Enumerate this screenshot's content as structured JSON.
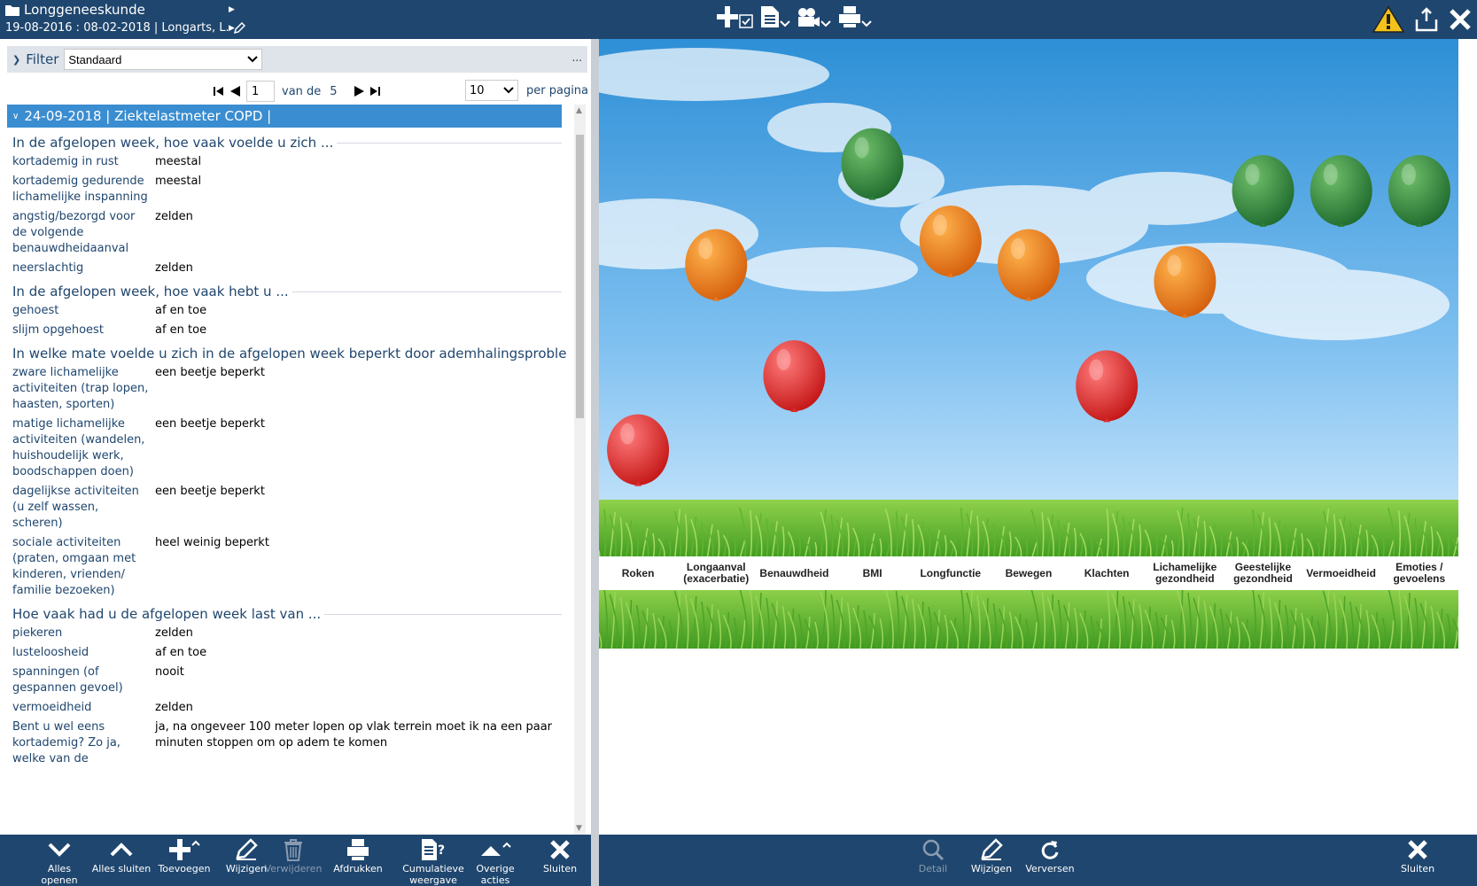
{
  "header": {
    "title": "Longgeneeskunde",
    "subtitle": "19-08-2016 : 08-02-2018 | Longarts, L."
  },
  "filter": {
    "label": "Filter",
    "selected": "Standaard",
    "more": "..."
  },
  "pager": {
    "page": "1",
    "of_label": "van de",
    "total": "5",
    "page_size": "10",
    "per_page_label": "per pagina"
  },
  "record": {
    "group_header": "24-09-2018 | Ziektelastmeter COPD |",
    "sections": [
      {
        "title": "In de afgelopen week, hoe vaak voelde u zich ...",
        "rows": [
          {
            "label": "kortademig in rust",
            "value": "meestal"
          },
          {
            "label": "kortademig gedurende lichamelijke inspanning",
            "value": "meestal"
          },
          {
            "label": "angstig/bezorgd voor de volgende benauwdheidaanval",
            "value": "zelden"
          },
          {
            "label": "neerslachtig",
            "value": "zelden"
          }
        ]
      },
      {
        "title": "In de afgelopen week, hoe vaak hebt u ...",
        "rows": [
          {
            "label": "gehoest",
            "value": "af en toe"
          },
          {
            "label": "slijm opgehoest",
            "value": "af en toe"
          }
        ]
      },
      {
        "title": "In welke mate voelde u zich in de afgelopen week beperkt door ademhalingsproblemen",
        "rows": [
          {
            "label": "zware lichamelijke activiteiten (trap lopen, haasten, sporten)",
            "value": "een beetje beperkt"
          },
          {
            "label": "matige lichamelijke activiteiten (wandelen, huishoudelijk werk, boodschappen doen)",
            "value": "een beetje beperkt"
          },
          {
            "label": "dagelijkse activiteiten (u zelf wassen, scheren)",
            "value": "een beetje beperkt"
          },
          {
            "label": "sociale activiteiten (praten, omgaan met kinderen, vrienden/ familie bezoeken)",
            "value": "heel weinig beperkt"
          }
        ]
      },
      {
        "title": "Hoe vaak had u de afgelopen week last van ...",
        "rows": [
          {
            "label": "piekeren",
            "value": "zelden"
          },
          {
            "label": "lusteloosheid",
            "value": "af en toe"
          },
          {
            "label": "spanningen (of gespannen gevoel)",
            "value": "nooit"
          },
          {
            "label": "vermoeidheid",
            "value": "zelden"
          },
          {
            "label": "Bent u wel eens kortademig? Zo ja, welke van de",
            "value": "ja, na ongeveer 100 meter lopen op vlak terrein moet ik na een paar minuten stoppen om op adem te komen"
          }
        ]
      }
    ]
  },
  "footer_left": {
    "open_all": "Alles openen",
    "close_all": "Alles sluiten",
    "add": "Toevoegen",
    "edit": "Wijzigen",
    "delete": "Verwijderen",
    "print": "Afdrukken",
    "cumulative": "Cumulatieve weergave",
    "other": "Overige acties",
    "close": "Sluiten"
  },
  "footer_right": {
    "detail": "Detail",
    "edit": "Wijzigen",
    "refresh": "Verversen",
    "close": "Sluiten"
  },
  "balloons": [
    {
      "label": "Roken",
      "status": "red",
      "level": 0.08
    },
    {
      "label": "Longaanval (exacerbatie)",
      "status": "orange",
      "level": 0.63
    },
    {
      "label": "Benauwdheid",
      "status": "red",
      "level": 0.3
    },
    {
      "label": "BMI",
      "status": "green",
      "level": 0.93
    },
    {
      "label": "Longfunctie",
      "status": "orange",
      "level": 0.7
    },
    {
      "label": "Bewegen",
      "status": "orange",
      "level": 0.63
    },
    {
      "label": "Klachten",
      "status": "red",
      "level": 0.27
    },
    {
      "label": "Lichamelijke gezondheid",
      "status": "orange",
      "level": 0.58
    },
    {
      "label": "Geestelijke gezondheid",
      "status": "green",
      "level": 0.85
    },
    {
      "label": "Vermoeidheid",
      "status": "green",
      "level": 0.85
    },
    {
      "label": "Emoties / gevoelens",
      "status": "green",
      "level": 0.85
    }
  ],
  "colors": {
    "header": "#1f466e",
    "accent": "#3a8dd0",
    "green": "#2e7d3a",
    "orange": "#e9771b",
    "red": "#de2a2a"
  }
}
